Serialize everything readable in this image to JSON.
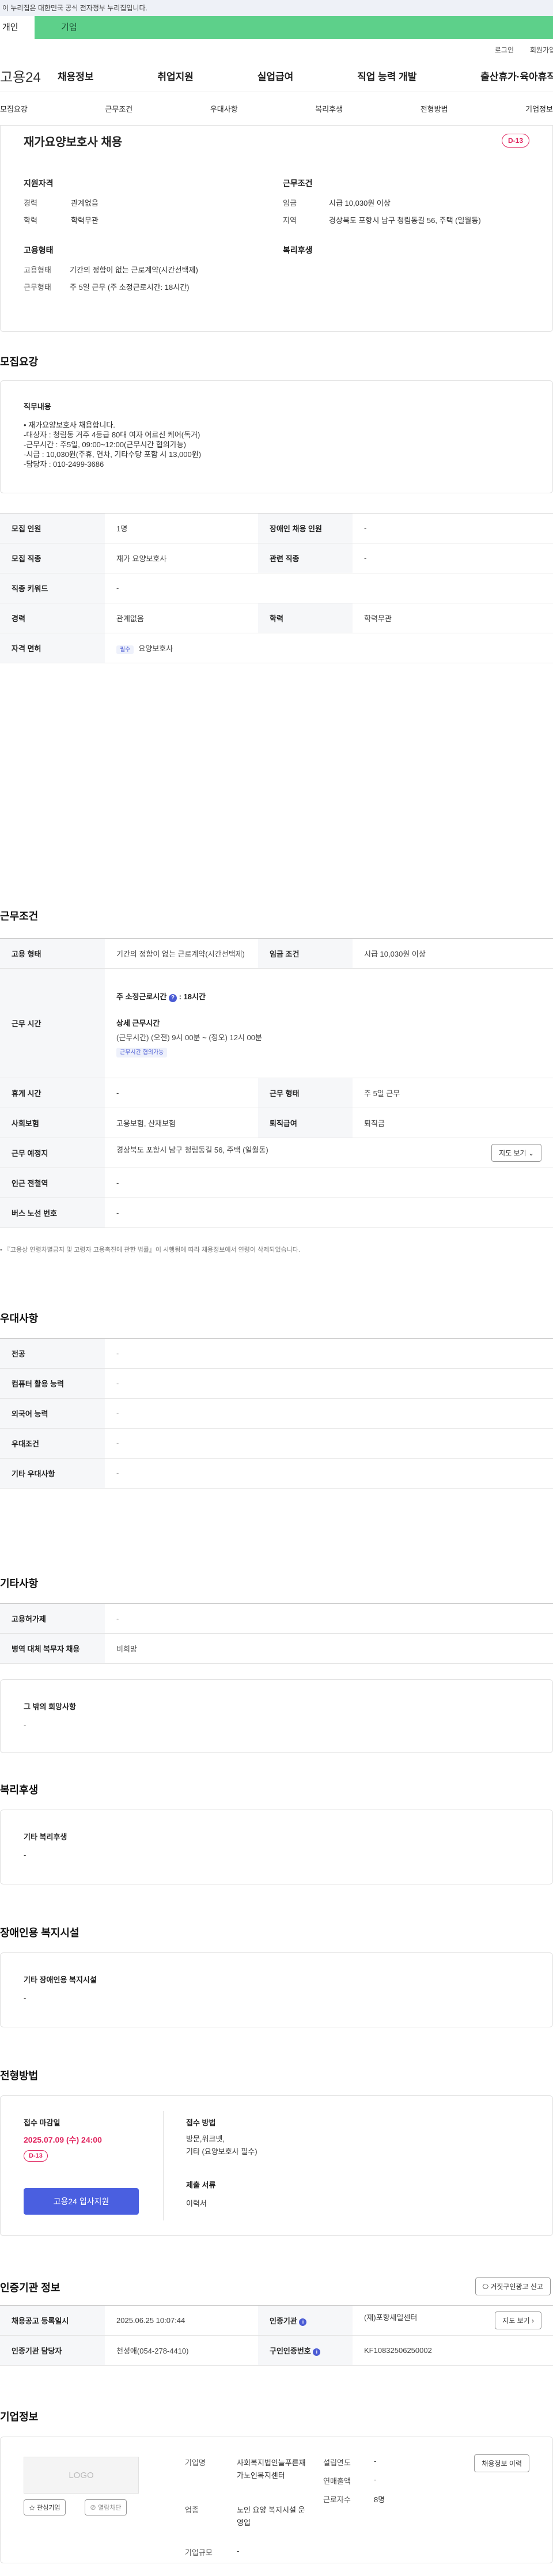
{
  "gov_banner": "이 누리집은 대한민국 공식 전자정부 누리집입니다.",
  "tabs": {
    "person": "개인",
    "company": "기업"
  },
  "util": {
    "login": "로그인",
    "signup": "회원가입"
  },
  "gnb": {
    "logo": "고용24",
    "menu": [
      "채용정보",
      "취업지원",
      "실업급여",
      "직업 능력 개발",
      "출산휴가·육아휴직"
    ]
  },
  "snb": [
    "모집요강",
    "근무조건",
    "우대사항",
    "복리후생",
    "전형방법",
    "기업정보"
  ],
  "summary": {
    "title": "재가요양보호사 채용",
    "dday": "D-13",
    "qual_title": "지원자격",
    "cond_title": "근무조건",
    "emp_title": "고용형태",
    "welfare_title": "복리후생",
    "qual": [
      {
        "k": "경력",
        "v": "관계없음"
      },
      {
        "k": "학력",
        "v": "학력무관"
      }
    ],
    "cond": [
      {
        "k": "임금",
        "v": "시급 10,030원 이상"
      },
      {
        "k": "지역",
        "v": "경상북도 포항시 남구 청림동길 56, 주택 (일월동)"
      }
    ],
    "emp": [
      {
        "k": "고용형태",
        "v": "기간의 정함이 없는 근로계약(시간선택제)"
      },
      {
        "k": "근무형태",
        "v": "주 5일 근무 (주 소정근로시간: 18시간)"
      }
    ]
  },
  "recruit": {
    "title": "모집요강",
    "duty_title": "직무내용",
    "duty_lines": [
      "• 재가요양보호사 채용합니다.",
      "-대상자 : 청림동 거주 4등급 80대 여자 어르신 케어(독거)",
      "-근무시간 : 주5일, 09:00~12:00(근무시간 협의가능)",
      "-시급 : 10,030원(주휴, 연차, 기타수당 포함 시 13,000원)",
      "-담당자 : 010-2499-3686"
    ],
    "rows": [
      {
        "k1": "모집 인원",
        "v1": "1명",
        "k2": "장애인 채용 인원",
        "v2": "-"
      },
      {
        "k1": "모집 직종",
        "v1": "재가 요양보호사",
        "k2": "관련 직종",
        "v2": "-"
      },
      {
        "k1": "직종 키워드",
        "v1": "-"
      },
      {
        "k1": "경력",
        "v1": "관계없음",
        "k2": "학력",
        "v2": "학력무관"
      }
    ],
    "license_label": "자격 면허",
    "license_tag": "필수",
    "license_value": "요양보호사"
  },
  "condition": {
    "title": "근무조건",
    "r1": {
      "k1": "고용 형태",
      "v1": "기간의 정함이 없는 근로계약(시간선택제)",
      "k2": "임금 조건",
      "v2": "시급 10,030원 이상"
    },
    "work_time_label": "근무 시간",
    "weekly": "주 소정근로시간",
    "weekly_val": ": 18시간",
    "detail_title": "상세 근무시간",
    "detail_line": "(근무시간) (오전) 9시 00분 ~ (정오) 12시 00분",
    "tag": "근무시간 협의가능",
    "r3": {
      "k1": "휴게 시간",
      "v1": "-",
      "k2": "근무 형태",
      "v2": "주 5일 근무"
    },
    "r4": {
      "k1": "사회보험",
      "v1": "고용보험, 산재보험",
      "k2": "퇴직급여",
      "v2": "퇴직금"
    },
    "place_label": "근무 예정지",
    "place_val": "경상북도 포항시 남구 청림동길 56, 주택 (일월동)",
    "map_btn": "지도 보기",
    "subway_label": "인근 전철역",
    "subway_val": "-",
    "bus_label": "버스 노선 번호",
    "bus_val": "-",
    "note": "• 『고용상 연령차별금지 및 고령자 고용촉진에 관한 법률』이 시행됨에 따라 채용정보에서 연령이 삭제되었습니다."
  },
  "prefer": {
    "title": "우대사항",
    "rows": [
      {
        "k": "전공",
        "v": "-"
      },
      {
        "k": "컴퓨터 활용 능력",
        "v": "-"
      },
      {
        "k": "외국어 능력",
        "v": "-"
      },
      {
        "k": "우대조건",
        "v": "-"
      },
      {
        "k": "기타 우대사항",
        "v": "-"
      }
    ]
  },
  "etc": {
    "title": "기타사항",
    "rows": [
      {
        "k": "고용허가제",
        "v": "-"
      },
      {
        "k": "병역 대체 복무자 채용",
        "v": "비희망"
      }
    ],
    "extra_title": "그 밖의 희망사항",
    "extra_val": "-"
  },
  "welfare": {
    "title": "복리후생",
    "box_title": "기타 복리후생",
    "box_val": "-"
  },
  "disability": {
    "title": "장애인용 복지시설",
    "box_title": "기타 장애인용 복지시설",
    "box_val": "-"
  },
  "selection": {
    "title": "전형방법",
    "deadline_label": "접수 마감일",
    "deadline": "2025.07.09 (수) 24:00",
    "dday": "D-13",
    "apply_btn": "고용24 입사지원",
    "method_label": "접수 방법",
    "method_lines": [
      "방문,워크넷,",
      "기타 (요양보호사 필수)"
    ],
    "docs_label": "제출 서류",
    "docs_val": "이력서"
  },
  "cert": {
    "title": "인증기관 정보",
    "report_btn": "거짓구인광고 신고",
    "r1": {
      "k1": "채용공고 등록일시",
      "v1": "2025.06.25 10:07:44",
      "k2": "인증기관",
      "v2": "(재)포항새일센터",
      "btn": "지도 보기"
    },
    "r2": {
      "k1": "인증기관 담당자",
      "v1": "천성애(054-278-4410)",
      "k2": "구인인증번호",
      "v2": "KF10832506250002"
    }
  },
  "company": {
    "title": "기업정보",
    "logo": "LOGO",
    "fav_btn": "관심기업",
    "block_btn": "열람차단",
    "name_label": "기업명",
    "name_val": "사회복지법인늘푸른재가노인복지센터",
    "est_label": "설립연도",
    "est_val": "-",
    "sales_label": "연매출액",
    "sales_val": "-",
    "emp_label": "근로자수",
    "emp_val": "8명",
    "ind_label": "업종",
    "ind_val": "노인 요양 복지시설 운영업",
    "size_label": "기업규모",
    "size_val": "-",
    "history_btn": "채용정보 이력"
  }
}
